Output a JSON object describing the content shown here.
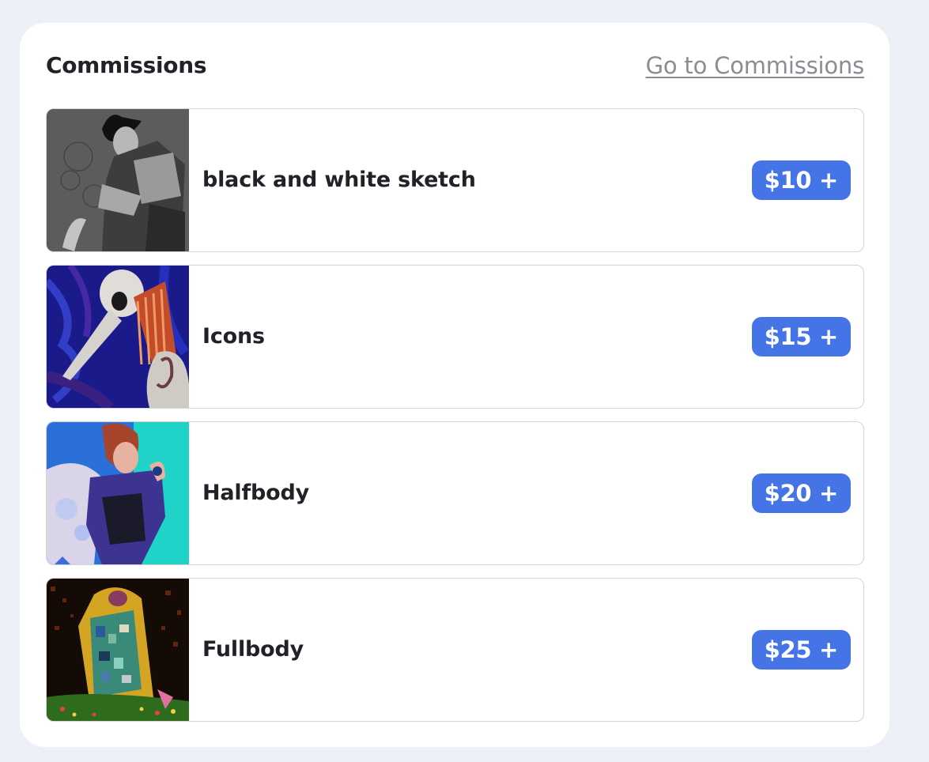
{
  "header": {
    "title": "Commissions",
    "link_label": "Go to Commissions"
  },
  "items": [
    {
      "label": "black and white sketch",
      "price": "$10 +"
    },
    {
      "label": "Icons",
      "price": "$15 +"
    },
    {
      "label": "Halfbody",
      "price": "$20 +"
    },
    {
      "label": "Fullbody",
      "price": "$25 +"
    }
  ],
  "colors": {
    "page_background": "#edf0f6",
    "card_background": "#ffffff",
    "price_badge": "#4574e6",
    "title_text": "#1f2227",
    "link_text": "#8a8d93"
  }
}
